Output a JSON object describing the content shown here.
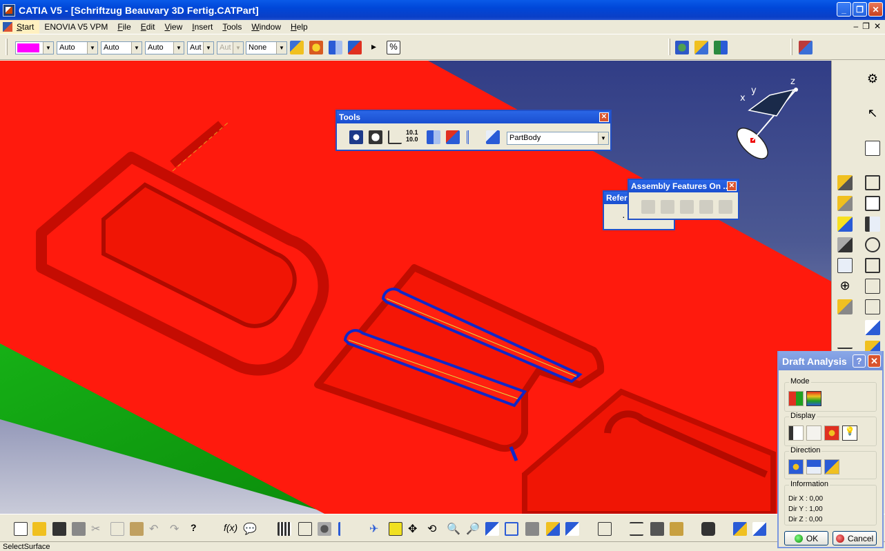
{
  "window": {
    "title": "CATIA V5 - [Schriftzug Beauvary 3D Fertig.CATPart]"
  },
  "menu": {
    "items": [
      "Start",
      "ENOVIA V5 VPM",
      "File",
      "Edit",
      "View",
      "Insert",
      "Tools",
      "Window",
      "Help"
    ]
  },
  "graphic_properties": {
    "color_value": "#ff00ff",
    "linetype": "Auto",
    "thickness": "Auto",
    "point_style": "Auto",
    "layer": "Aut",
    "disabled_combo": "Aut",
    "rendering": "None"
  },
  "tools_toolbar": {
    "title": "Tools",
    "body_selector": "PartBody"
  },
  "reference_toolbar": {
    "title": "Refer"
  },
  "assembly_toolbar": {
    "title": "Assembly Features On ..."
  },
  "compass": {
    "x": "x",
    "y": "y",
    "z": "z"
  },
  "draft_analysis": {
    "title": "Draft Analysis",
    "help": "?",
    "mode_label": "Mode",
    "display_label": "Display",
    "direction_label": "Direction",
    "information_label": "Information",
    "dir_x": "Dir X : 0,00",
    "dir_y": "Dir Y : 1,00",
    "dir_z": "Dir Z : 0,00",
    "ok": "OK",
    "cancel": "Cancel"
  },
  "status": {
    "text": "SelectSurface"
  },
  "colors": {
    "part_red": "#ff1a0d",
    "side_green": "#10a010",
    "edge_blue": "#1028c8",
    "background_top": "#313d86"
  }
}
